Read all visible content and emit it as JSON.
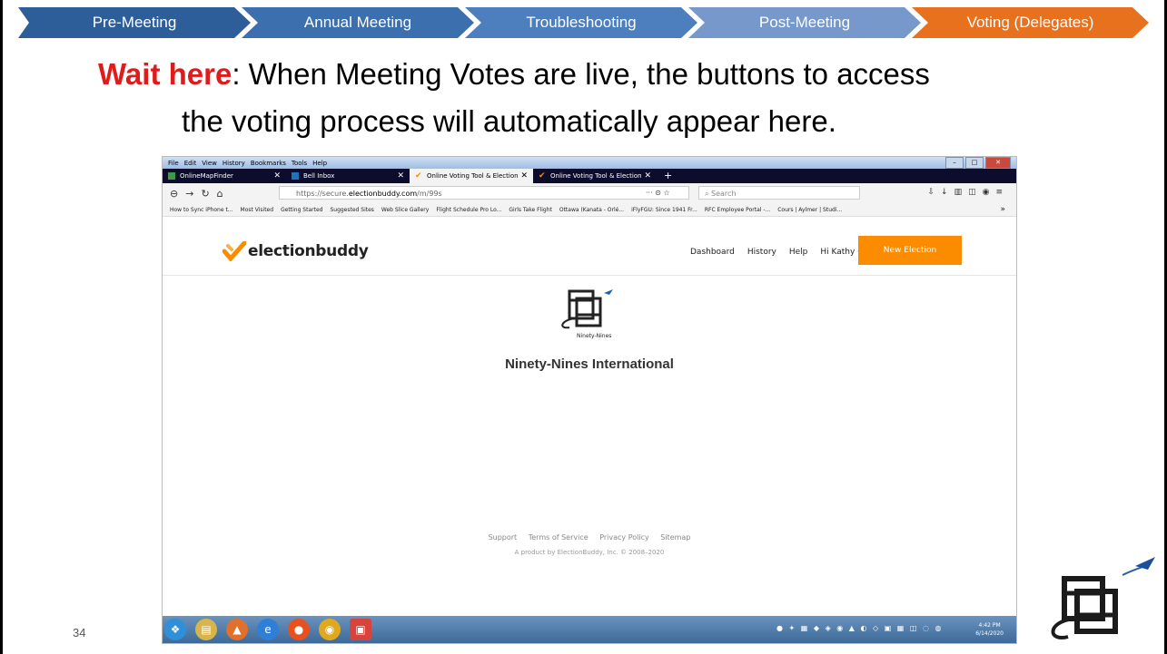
{
  "nav": {
    "steps": [
      "Pre-Meeting",
      "Annual Meeting",
      "Troubleshooting",
      "Post-Meeting",
      "Voting (Delegates)"
    ]
  },
  "headline": {
    "emphasis": "Wait here",
    "line1_rest": ": When Meeting Votes are live, the buttons to access",
    "line2": "the voting process will automatically  appear here."
  },
  "browser": {
    "menu": [
      "File",
      "Edit",
      "View",
      "History",
      "Bookmarks",
      "Tools",
      "Help"
    ],
    "tabs": [
      {
        "label": "OnlineMapFinder",
        "icon_color": "#3c9b48"
      },
      {
        "label": "Bell Inbox",
        "icon_color": "#1e73be"
      },
      {
        "label": "Online Voting Tool & Election",
        "icon_color": "#fb8c00"
      },
      {
        "label": "Online Voting Tool & Election",
        "icon_color": "#fb8c00"
      }
    ],
    "url_prefix": "https://secure.",
    "url_domain": "electionbuddy.com",
    "url_path": "/m/99s",
    "url_actions": "··· ⊙ ☆",
    "search_placeholder": "Search",
    "bookmarks": [
      "How to Sync iPhone t...",
      "Most Visited",
      "Getting Started",
      "Suggested Sites",
      "Web Slice Gallery",
      "Flight Schedule Pro Lo...",
      "Girls Take Flight",
      "Ottawa (Kanata - Orlé...",
      "iFlyFGU: Since 1941 Fr...",
      "RFC Employee Portal -...",
      "Cours | Aylmer | Studi..."
    ]
  },
  "site": {
    "logo_text": "electionbuddy",
    "nav": [
      "Dashboard",
      "History",
      "Help",
      "Hi Kathy ⌵"
    ],
    "new_election": "New Election",
    "org_logo_caption": "Ninety-Nines",
    "org_name": "Ninety-Nines International",
    "footer_links": [
      "Support",
      "Terms of Service",
      "Privacy Policy",
      "Sitemap"
    ],
    "copyright": "A product by ElectionBuddy, Inc. © 2008–2020"
  },
  "taskbar": {
    "time": "4:42 PM",
    "date": "6/14/2020"
  },
  "slide_number": "34",
  "colors": {
    "accent_orange": "#e8711e",
    "nav_blue": "#2e5e99",
    "emphasis_red": "#e01b1b",
    "eb_orange": "#fb8c00"
  }
}
